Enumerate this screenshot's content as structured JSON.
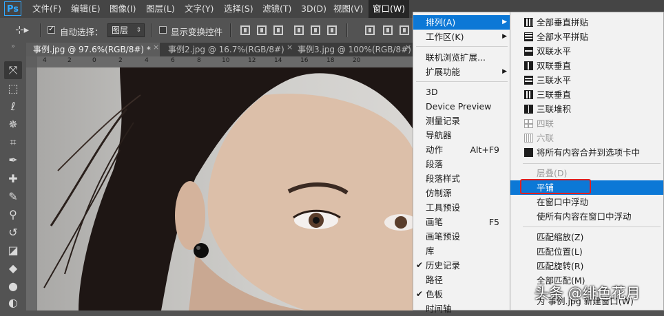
{
  "app": {
    "logo": "Ps"
  },
  "menubar": {
    "items": [
      "文件(F)",
      "编辑(E)",
      "图像(I)",
      "图层(L)",
      "文字(Y)",
      "选择(S)",
      "滤镜(T)",
      "3D(D)",
      "视图(V)",
      "窗口(W)"
    ],
    "active": "窗口(W)"
  },
  "options": {
    "auto_select_label": "自动选择：",
    "auto_select_checked": true,
    "layer_select_value": "图层",
    "show_transform_label": "显示变换控件",
    "show_transform_checked": false
  },
  "tabs": [
    {
      "label": "事例.jpg @ 97.6%(RGB/8#) *",
      "active": true
    },
    {
      "label": "事例2.jpg @ 16.7%(RGB/8#)",
      "active": false
    },
    {
      "label": "事例3.jpg @ 100%(RGB/8#)",
      "active": false
    }
  ],
  "ruler": {
    "marks": [
      "4",
      "2",
      "0",
      "2",
      "4",
      "6",
      "8",
      "10",
      "12",
      "14",
      "16",
      "18",
      "20"
    ]
  },
  "window_menu": {
    "items": [
      {
        "label": "排列(A)",
        "submenu": true,
        "highlight": true
      },
      {
        "label": "工作区(K)",
        "submenu": true
      },
      {
        "separator": true
      },
      {
        "label": "联机浏览扩展..."
      },
      {
        "label": "扩展功能",
        "submenu": true
      },
      {
        "separator": true
      },
      {
        "label": "3D"
      },
      {
        "label": "Device Preview"
      },
      {
        "label": "测量记录"
      },
      {
        "label": "导航器"
      },
      {
        "label": "动作",
        "shortcut": "Alt+F9"
      },
      {
        "label": "段落"
      },
      {
        "label": "段落样式"
      },
      {
        "label": "仿制源"
      },
      {
        "label": "工具预设"
      },
      {
        "label": "画笔",
        "shortcut": "F5"
      },
      {
        "label": "画笔预设"
      },
      {
        "label": "库"
      },
      {
        "label": "历史记录",
        "checked": true
      },
      {
        "label": "路径"
      },
      {
        "label": "色板",
        "checked": true
      },
      {
        "label": "时间轴"
      }
    ]
  },
  "arrange_menu": {
    "items": [
      {
        "label": "全部垂直拼贴",
        "icon": "tile-vertical-icon"
      },
      {
        "label": "全部水平拼贴",
        "icon": "tile-horizontal-icon"
      },
      {
        "label": "双联水平",
        "icon": "two-up-horizontal-icon"
      },
      {
        "label": "双联垂直",
        "icon": "two-up-vertical-icon"
      },
      {
        "label": "三联水平",
        "icon": "three-up-horizontal-icon"
      },
      {
        "label": "三联垂直",
        "icon": "three-up-vertical-icon"
      },
      {
        "label": "三联堆积",
        "icon": "three-up-stacked-icon"
      },
      {
        "label": "四联",
        "icon": "four-up-icon",
        "disabled": true
      },
      {
        "label": "六联",
        "icon": "six-up-icon",
        "disabled": true
      },
      {
        "label": "将所有内容合并到选项卡中",
        "icon": "consolidate-tabs-icon"
      },
      {
        "separator": true
      },
      {
        "label": "层叠(D)",
        "disabled": true
      },
      {
        "label": "平铺",
        "highlight": true
      },
      {
        "label": "在窗口中浮动"
      },
      {
        "label": "使所有内容在窗口中浮动"
      },
      {
        "separator": true
      },
      {
        "label": "匹配缩放(Z)"
      },
      {
        "label": "匹配位置(L)"
      },
      {
        "label": "匹配旋转(R)"
      },
      {
        "label": "全部匹配(M)"
      },
      {
        "label": "为 事例.jpg 新建窗口(W)"
      }
    ]
  },
  "watermark": "头条 @绯色花月",
  "colors": {
    "menu_highlight": "#0c78d6",
    "annotation_box": "#e02020"
  }
}
